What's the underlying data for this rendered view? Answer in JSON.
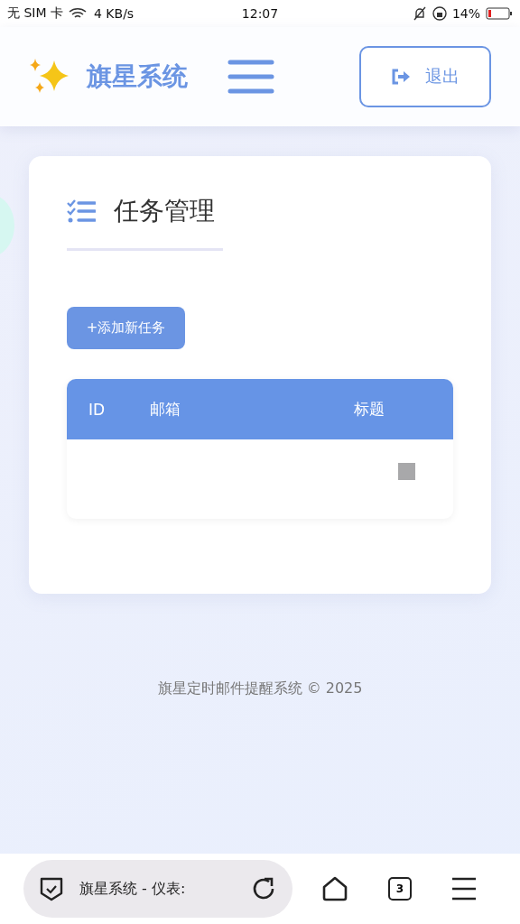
{
  "status_bar": {
    "carrier": "无 SIM 卡",
    "speed": "4 KB/s",
    "time": "12:07",
    "battery": "14%"
  },
  "header": {
    "brand": "旗星系统",
    "logout": "退出"
  },
  "panel": {
    "title": "任务管理",
    "add_button": "+添加新任务",
    "table": {
      "columns": [
        "ID",
        "邮箱",
        "标题"
      ]
    }
  },
  "footer": "旗星定时邮件提醒系统 © 2025",
  "browser_bar": {
    "page_title": "旗星系统 - 仪表:",
    "tab_count": "3"
  }
}
